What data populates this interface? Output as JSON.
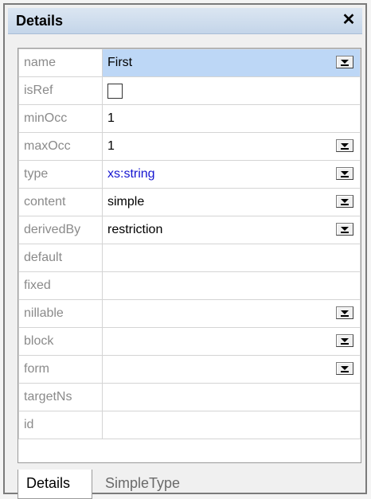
{
  "window": {
    "title": "Details",
    "close_glyph": "✕"
  },
  "properties": [
    {
      "name": "name",
      "value": "First",
      "dropdown": true,
      "selected": true,
      "link": false
    },
    {
      "name": "isRef",
      "value": "",
      "checkbox": true
    },
    {
      "name": "minOcc",
      "value": "1",
      "dropdown": false
    },
    {
      "name": "maxOcc",
      "value": "1",
      "dropdown": true
    },
    {
      "name": "type",
      "value": "xs:string",
      "dropdown": true,
      "link": true
    },
    {
      "name": "content",
      "value": "simple",
      "dropdown": true
    },
    {
      "name": "derivedBy",
      "value": "restriction",
      "dropdown": true
    },
    {
      "name": "default",
      "value": "",
      "dropdown": false
    },
    {
      "name": "fixed",
      "value": "",
      "dropdown": false
    },
    {
      "name": "nillable",
      "value": "",
      "dropdown": true
    },
    {
      "name": "block",
      "value": "",
      "dropdown": true
    },
    {
      "name": "form",
      "value": "",
      "dropdown": true
    },
    {
      "name": "targetNs",
      "value": "",
      "dropdown": false
    },
    {
      "name": "id",
      "value": "",
      "dropdown": false
    }
  ],
  "tabs": [
    {
      "label": "Details",
      "active": true
    },
    {
      "label": "SimpleType",
      "active": false
    }
  ],
  "colors": {
    "title_bar": "#c4d5e9",
    "selected_cell": "#bdd7f6",
    "link_text": "#1515d0",
    "prop_text": "#8a8a8a"
  }
}
